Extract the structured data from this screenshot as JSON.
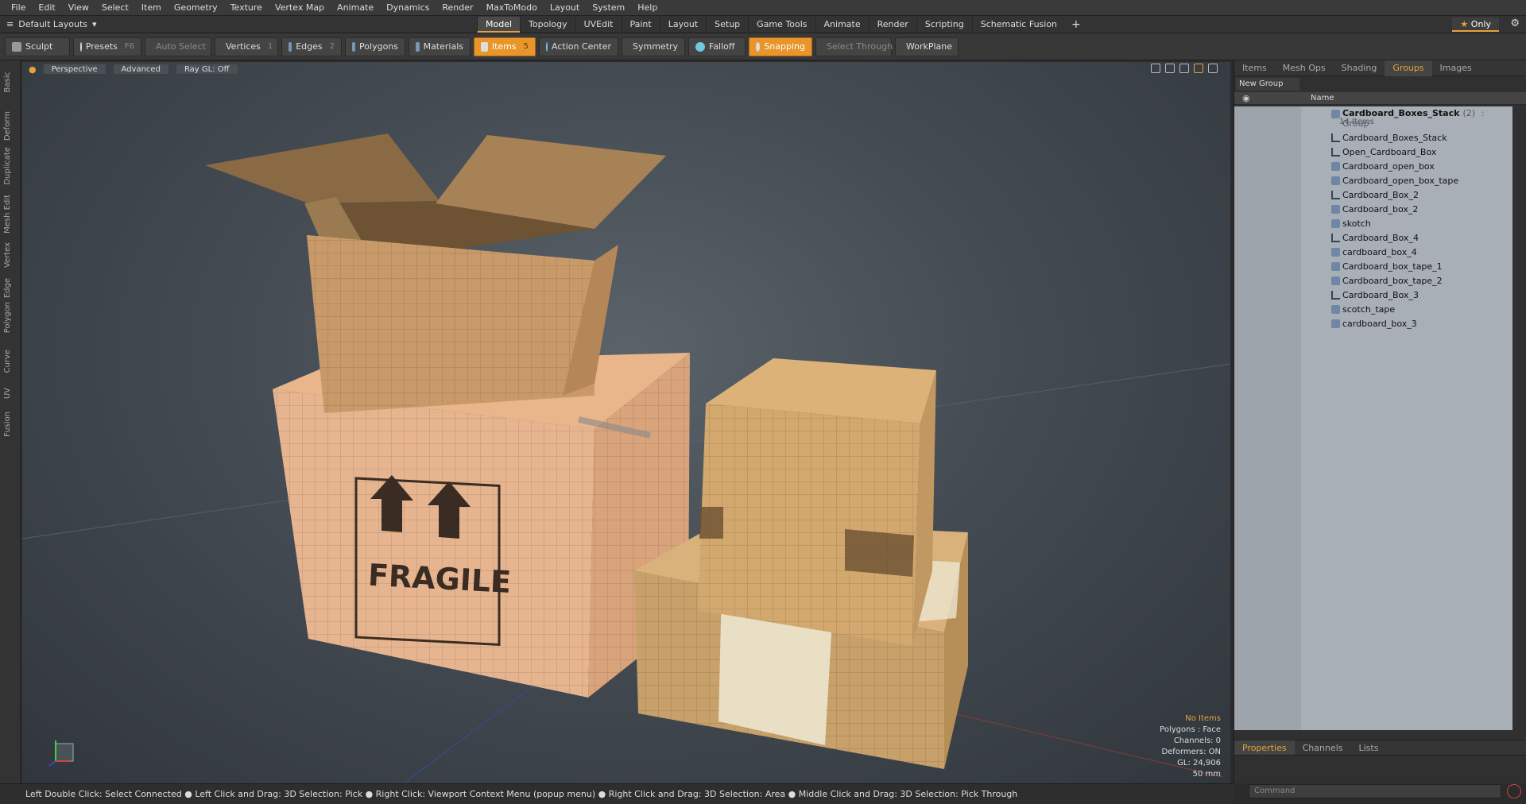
{
  "menu": [
    "File",
    "Edit",
    "View",
    "Select",
    "Item",
    "Geometry",
    "Texture",
    "Vertex Map",
    "Animate",
    "Dynamics",
    "Render",
    "MaxToModo",
    "Layout",
    "System",
    "Help"
  ],
  "layouts_label": "Default Layouts",
  "main_tabs": [
    "Model",
    "Topology",
    "UVEdit",
    "Paint",
    "Layout",
    "Setup",
    "Game Tools",
    "Animate",
    "Render",
    "Scripting",
    "Schematic Fusion"
  ],
  "active_tab": "Model",
  "only_label": "Only",
  "toolbar": {
    "sculpt": "Sculpt",
    "presets": "Presets",
    "presets_key": "F6",
    "auto_select": "Auto Select",
    "vertices": "Vertices",
    "vertices_key": "1",
    "edges": "Edges",
    "edges_key": "2",
    "polygons": "Polygons",
    "materials": "Materials",
    "items": "Items",
    "items_key": "5",
    "action_center": "Action Center",
    "symmetry": "Symmetry",
    "falloff": "Falloff",
    "snapping": "Snapping",
    "select_through": "Select Through",
    "workplane": "WorkPlane"
  },
  "left_tabs": [
    "Basic",
    "Deform",
    "Duplicate",
    "Mesh Edit",
    "Vertex",
    "Edge",
    "Polygon",
    "Curve",
    "UV",
    "Fusion"
  ],
  "viewport": {
    "view": "Perspective",
    "shading": "Advanced",
    "raygl": "Ray GL: Off",
    "fragile_text": "FRAGILE",
    "stats": [
      "No Items",
      "Polygons : Face",
      "Channels: 0",
      "Deformers: ON",
      "GL: 24,906",
      "50 mm"
    ]
  },
  "right_panel": {
    "tabs": [
      "Items",
      "Mesh Ops",
      "Shading",
      "Groups",
      "Images"
    ],
    "active_tab": "Groups",
    "new_group": "New Group",
    "name_header": "Name",
    "group": {
      "name": "Cardboard_Boxes_Stack",
      "count": "(2)",
      "type": ": Group",
      "sub": "14 Items"
    },
    "items": [
      {
        "name": "Cardboard_Boxes_Stack",
        "kind": "locator"
      },
      {
        "name": "Open_Cardboard_Box",
        "kind": "locator"
      },
      {
        "name": "Cardboard_open_box",
        "kind": "mesh"
      },
      {
        "name": "Cardboard_open_box_tape",
        "kind": "mesh"
      },
      {
        "name": "Cardboard_Box_2",
        "kind": "locator"
      },
      {
        "name": "Cardboard_box_2",
        "kind": "mesh"
      },
      {
        "name": "skotch",
        "kind": "mesh"
      },
      {
        "name": "Cardboard_Box_4",
        "kind": "locator"
      },
      {
        "name": "cardboard_box_4",
        "kind": "mesh"
      },
      {
        "name": "Cardboard_box_tape_1",
        "kind": "mesh"
      },
      {
        "name": "Cardboard_box_tape_2",
        "kind": "mesh"
      },
      {
        "name": "Cardboard_Box_3",
        "kind": "locator"
      },
      {
        "name": "scotch_tape",
        "kind": "mesh"
      },
      {
        "name": "cardboard_box_3",
        "kind": "mesh"
      }
    ],
    "lower_tabs": [
      "Properties",
      "Channels",
      "Lists"
    ],
    "lower_active": "Properties",
    "command_placeholder": "Command"
  },
  "status_bar": "Left Double Click: Select Connected ● Left Click and Drag: 3D Selection: Pick ● Right Click: Viewport Context Menu (popup menu) ● Right Click and Drag: 3D Selection: Area ● Middle Click and Drag: 3D Selection: Pick Through",
  "colors": {
    "accent": "#e8952a",
    "list_bg": "#a9afb6"
  }
}
